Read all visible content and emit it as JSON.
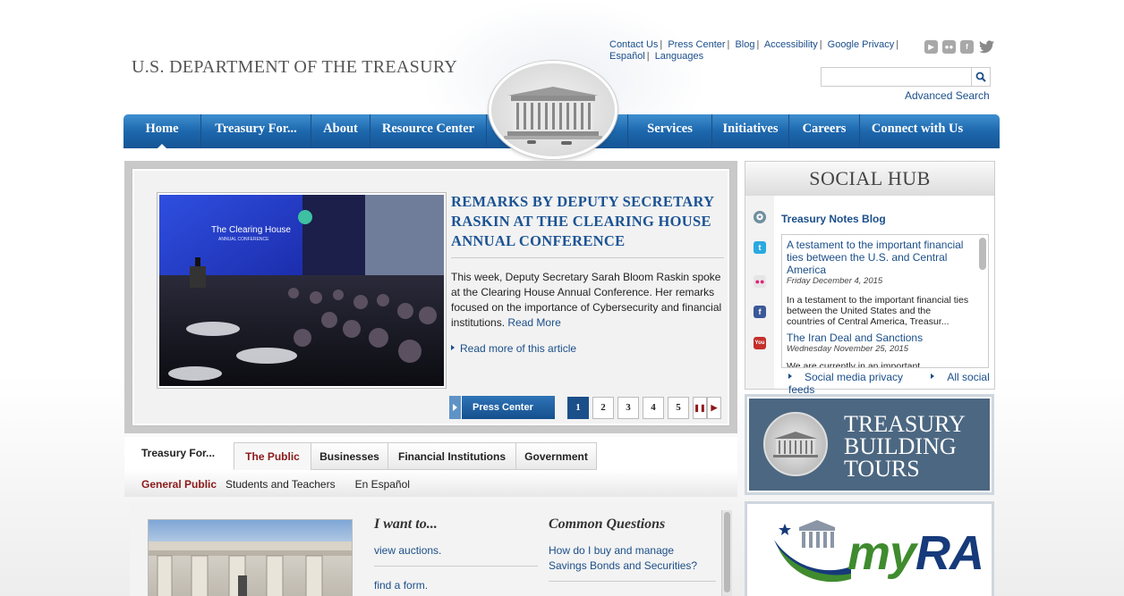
{
  "header": {
    "site_title": "U.S. DEPARTMENT OF THE TREASURY",
    "util_links": [
      "Contact Us",
      "Press Center",
      "Blog",
      "Accessibility",
      "Google Privacy",
      "Español",
      "Languages"
    ],
    "social_icons": [
      "youtube-icon",
      "flickr-icon",
      "facebook-icon",
      "twitter-icon"
    ],
    "search_placeholder": "",
    "advanced_search": "Advanced Search"
  },
  "nav": {
    "items": [
      "Home",
      "Treasury For...",
      "About",
      "Resource Center",
      "Services",
      "Initiatives",
      "Careers",
      "Connect with Us"
    ]
  },
  "carousel": {
    "headline": "REMARKS BY DEPUTY SECRETARY RASKIN AT THE CLEARING HOUSE ANNUAL CONFERENCE",
    "summary": "This week, Deputy Secretary Sarah Bloom Raskin spoke at the Clearing House Annual Conference. Her remarks focused on the importance of Cybersecurity and financial institutions.",
    "read_more": "Read More",
    "read_more_article": "Read more of this article",
    "press_center": "Press Center",
    "pages": [
      "1",
      "2",
      "3",
      "4",
      "5"
    ],
    "pause": "❚❚",
    "next": "▶",
    "photo_sign": "The Clearing House",
    "photo_sign_sub": "ANNUAL CONFERENCE"
  },
  "tabs": {
    "label": "Treasury For...",
    "items": [
      "The Public",
      "Businesses",
      "Financial Institutions",
      "Government"
    ],
    "subtabs": [
      "General Public",
      "Students and Teachers",
      "En Español"
    ]
  },
  "lower": {
    "iwant_title": "I want to...",
    "iwant_links": [
      "view auctions.",
      "find a form."
    ],
    "cq_title": "Common Questions",
    "cq_link": "How do I buy and manage Savings Bonds and Securities?"
  },
  "social_hub": {
    "title": "SOCIAL HUB",
    "blog_title": "Treasury Notes Blog",
    "posts": [
      {
        "title": "A testament to the important financial ties between the U.S. and Central America",
        "date": "Friday December 4, 2015",
        "body": "In a testament to the important financial ties between the United States and the countries of Central America, Treasur..."
      },
      {
        "title": "The Iran Deal and Sanctions",
        "date": "Wednesday November 25, 2015",
        "body": "We are currently in an important"
      }
    ],
    "links": [
      "Social media privacy",
      "All social feeds"
    ]
  },
  "tours": {
    "line1": "TREASURY",
    "line2": "BUILDING",
    "line3": "TOURS"
  },
  "myra": {
    "my": "my",
    "ra": "RA"
  }
}
